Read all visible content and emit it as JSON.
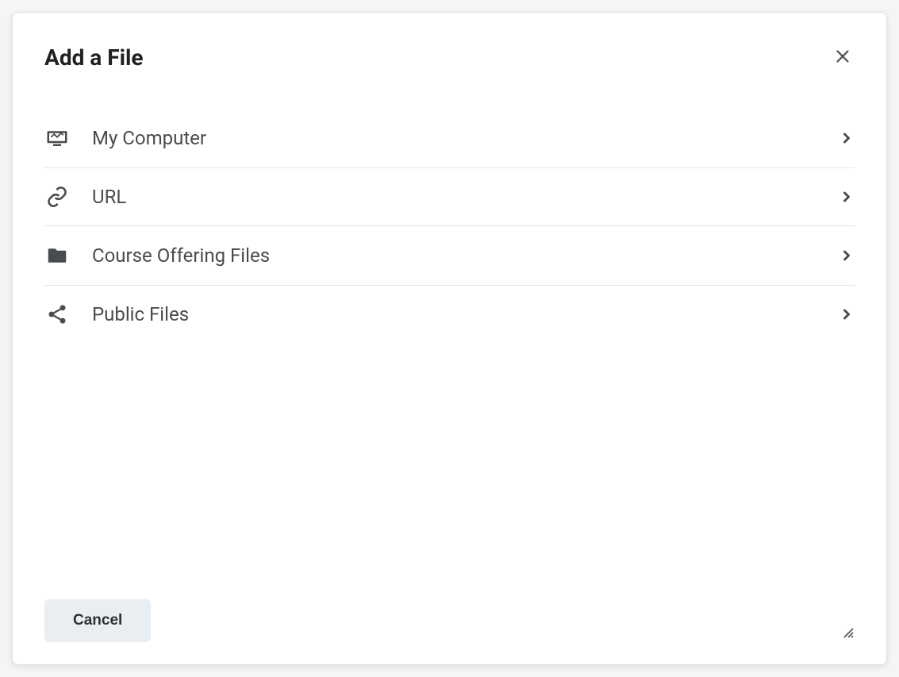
{
  "dialog": {
    "title": "Add a File",
    "options": [
      {
        "label": "My Computer",
        "icon": "computer"
      },
      {
        "label": "URL",
        "icon": "link"
      },
      {
        "label": "Course Offering Files",
        "icon": "folder"
      },
      {
        "label": "Public Files",
        "icon": "share"
      }
    ],
    "cancel_label": "Cancel"
  }
}
